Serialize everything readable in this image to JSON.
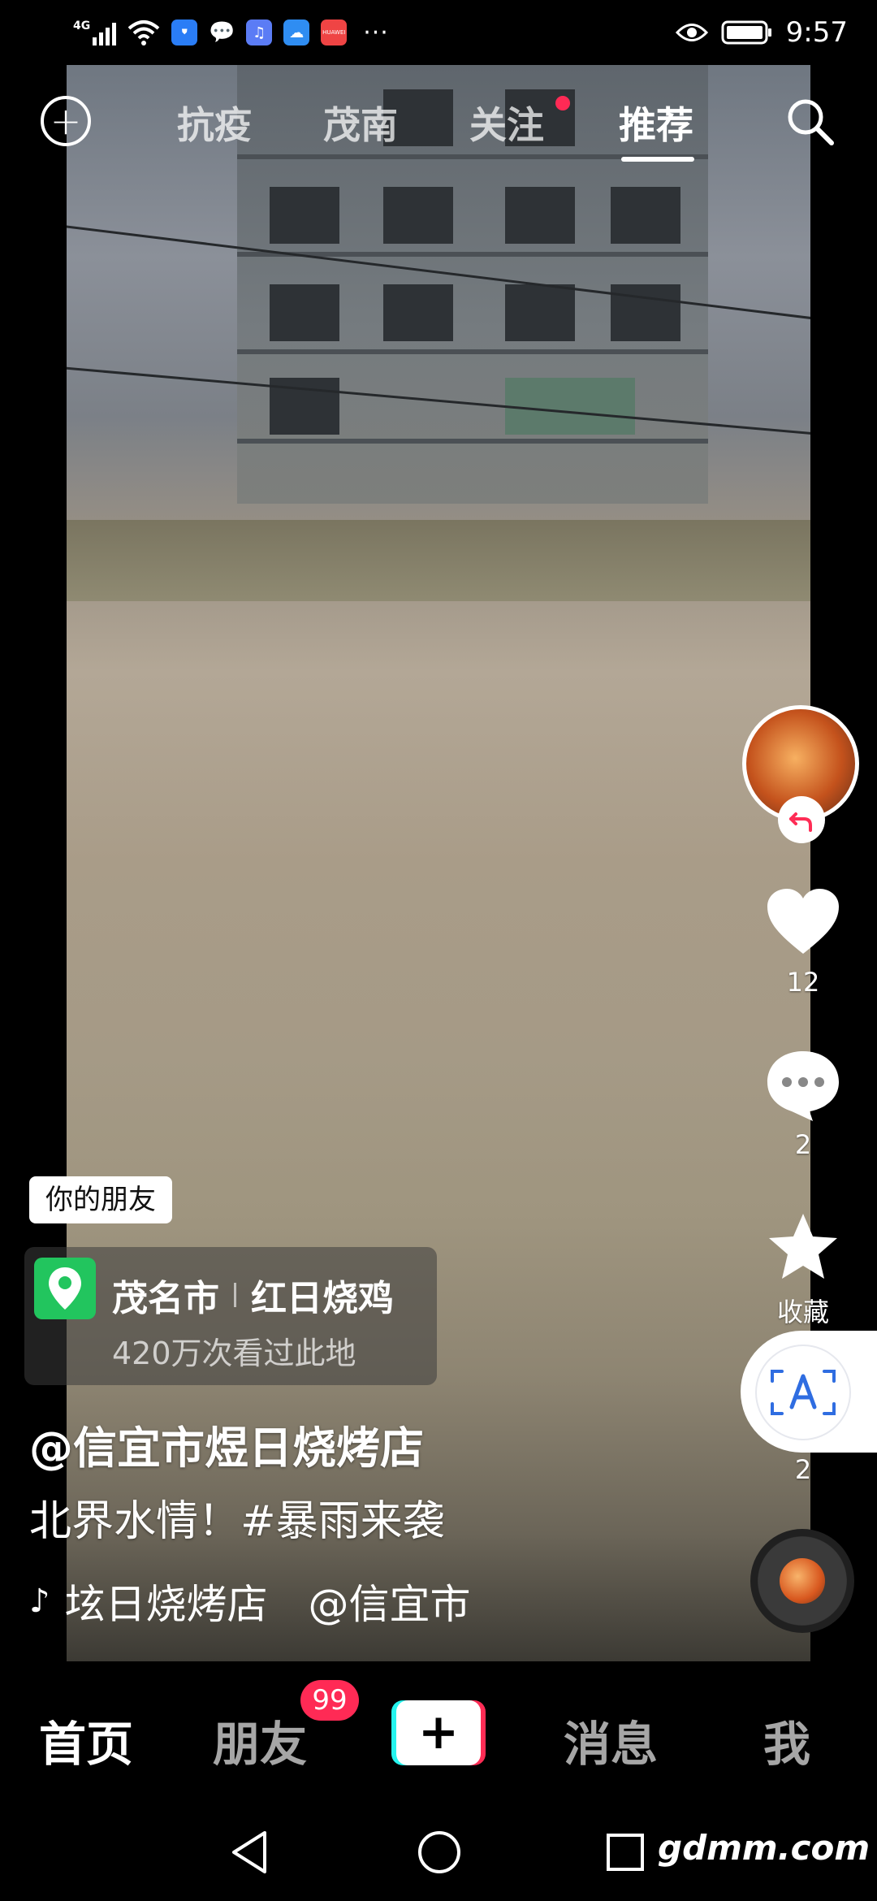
{
  "status_bar": {
    "signal_label": "4G",
    "time": "9:57",
    "apps": [
      "shield-app-icon",
      "wechat-icon",
      "music-app-icon",
      "cloud-app-icon",
      "huawei-app-icon"
    ],
    "huawei_label": "HUAWEI",
    "more": "···"
  },
  "top_nav": {
    "tabs": [
      "抗疫",
      "茂南",
      "关注",
      "推荐"
    ],
    "active_tab": "推荐"
  },
  "rail": {
    "likes": "12",
    "comments": "2",
    "favorite_label": "收藏",
    "shares": "2"
  },
  "video_info": {
    "friend_badge": "你的朋友",
    "location_city": "茂名市",
    "location_place": "红日烧鸡",
    "location_views": "420万次看过此地",
    "author": "@信宜市煜日烧烤店",
    "caption": "北界水情！#暴雨来袭",
    "music_text": "𡊨日烧烤店　@信宜市"
  },
  "tab_bar": {
    "home": "首页",
    "friends": "朋友",
    "friends_badge": "99",
    "create": "+",
    "messages": "消息",
    "me": "我"
  },
  "watermark": "gdmm.com",
  "colors": {
    "accent_red": "#fe2c55",
    "accent_cyan": "#25f4ee",
    "location_green": "#22c55e"
  }
}
